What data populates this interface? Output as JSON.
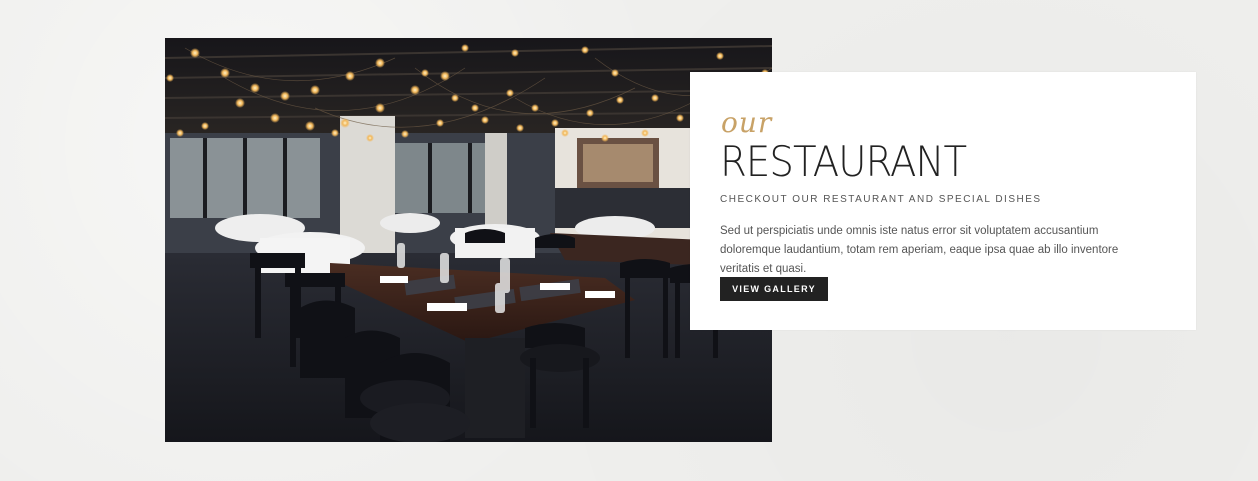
{
  "section": {
    "script_label": "our",
    "title": "RESTAURANT",
    "subtitle": "CHECKOUT OUR RESTAURANT AND SPECIAL DISHES",
    "description": "Sed ut perspiciatis unde omnis iste natus error sit voluptatem accusantium doloremque laudantium, totam rem aperiam, eaque ipsa quae ab illo inventore veritatis et quasi.",
    "button_label": "VIEW GALLERY"
  },
  "colors": {
    "accent": "#c8a267",
    "button_bg": "#222222",
    "page_bg": "#efefed"
  },
  "image": {
    "subject": "restaurant-interior-photo"
  }
}
